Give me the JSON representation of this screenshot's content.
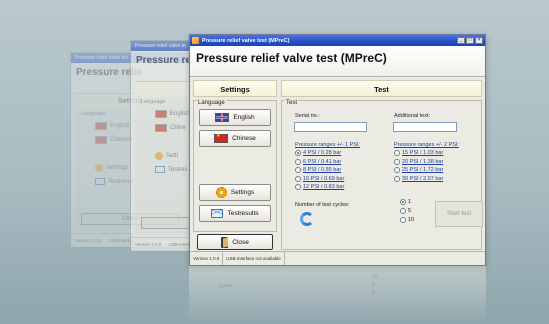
{
  "ghost_windows": [
    {
      "title": "Pressure relief valve tes",
      "header": "Pressure relie",
      "settings": "Setting",
      "language": "Language",
      "english": "English",
      "chinese": "Chinese",
      "settings_btn": "Settings",
      "testresults": "Testresult",
      "close": "Close",
      "version": "Version 1.0.0",
      "usb": "USB-interfac"
    },
    {
      "title": "Pressure relief valve te",
      "header": "Pressure reli",
      "settings": "Setting",
      "language": "Language",
      "english": "English",
      "chinese": "Chine",
      "settings_btn": "Setti",
      "testresults": "Testres",
      "close": "Clos",
      "version": "Version 1.0.0",
      "usb": "USB-interfac"
    }
  ],
  "window": {
    "title": "Pressure relief valve test (MPreC)",
    "controls": {
      "minimize": "_",
      "maximize": "□",
      "close": "×"
    }
  },
  "header": {
    "title": "Pressure relief valve test (MPreC)"
  },
  "settings_panel": {
    "heading": "Settings",
    "group_label": "Language",
    "english_label": "English",
    "chinese_label": "Chinese",
    "settings_label": "Settings",
    "testresults_label": "Testresults",
    "close_label": "Close"
  },
  "test_panel": {
    "heading": "Test",
    "group_label": "Test",
    "serial_label": "Serial no.:",
    "serial_value": "",
    "additional_label": "Additional text:",
    "additional_value": "",
    "range1_title": "Pressure ranges +/- 1 PSI:",
    "range1_options": [
      {
        "label": "4  PSI / 0.28 bar",
        "checked": true
      },
      {
        "label": "6  PSI / 0.41 bar",
        "checked": false
      },
      {
        "label": "8  PSI / 0.55 bar",
        "checked": false
      },
      {
        "label": "10 PSI / 0.69 bar",
        "checked": false
      },
      {
        "label": "12  PSI / 0.83 bar",
        "checked": false
      }
    ],
    "range2_title": "Pressure ranges +/- 2 PSI:",
    "range2_options": [
      {
        "label": "15  PSI / 1.03 bar",
        "checked": false
      },
      {
        "label": "20  PSI / 1.38 bar",
        "checked": false
      },
      {
        "label": "25  PSI / 1.72 bar",
        "checked": false
      },
      {
        "label": "30 PSI / 2.07 bar",
        "checked": false
      }
    ],
    "cycles_label": "Number of test cycles:",
    "cycle_options": [
      {
        "label": "1",
        "checked": true
      },
      {
        "label": "5",
        "checked": false
      },
      {
        "label": "10",
        "checked": false
      }
    ],
    "start_label": "Start test"
  },
  "status_bar": {
    "version": "Version 1.0.0",
    "usb": "USB-interface not available"
  },
  "reflection": {
    "cycle_a": "10",
    "cycle_b": "5",
    "cycle_c": "1",
    "close": "Close"
  },
  "colors": {
    "titlebar": "#2450c7",
    "link_blue": "#1d3fa0",
    "section_header": "#f4f1d4",
    "background": "#a9bcc2"
  }
}
